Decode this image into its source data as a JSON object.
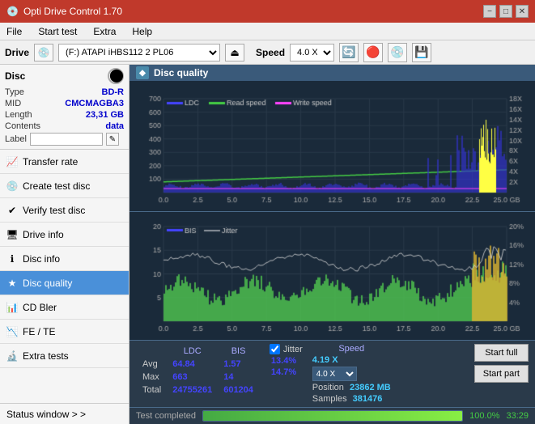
{
  "titlebar": {
    "title": "Opti Drive Control 1.70",
    "icon": "💿",
    "minimize": "−",
    "maximize": "□",
    "close": "✕"
  },
  "menu": {
    "items": [
      "File",
      "Start test",
      "Extra",
      "Help"
    ]
  },
  "drivebar": {
    "drive_label": "Drive",
    "drive_value": "(F:) ATAPI iHBS112  2 PL06",
    "speed_label": "Speed",
    "speed_value": "4.0 X"
  },
  "sidebar": {
    "disc_section": "Disc",
    "disc_type_key": "Type",
    "disc_type_val": "BD-R",
    "disc_mid_key": "MID",
    "disc_mid_val": "CMCMAGBA3",
    "disc_length_key": "Length",
    "disc_length_val": "23,31 GB",
    "disc_contents_key": "Contents",
    "disc_contents_val": "data",
    "disc_label_key": "Label",
    "disc_label_val": "",
    "nav_items": [
      {
        "id": "transfer-rate",
        "label": "Transfer rate",
        "icon": "📈",
        "active": false
      },
      {
        "id": "create-test-disc",
        "label": "Create test disc",
        "icon": "💿",
        "active": false
      },
      {
        "id": "verify-test-disc",
        "label": "Verify test disc",
        "icon": "✔",
        "active": false
      },
      {
        "id": "drive-info",
        "label": "Drive info",
        "icon": "🖥",
        "active": false
      },
      {
        "id": "disc-info",
        "label": "Disc info",
        "icon": "ℹ",
        "active": false
      },
      {
        "id": "disc-quality",
        "label": "Disc quality",
        "icon": "★",
        "active": true
      },
      {
        "id": "cd-bler",
        "label": "CD Bler",
        "icon": "📊",
        "active": false
      },
      {
        "id": "fe-te",
        "label": "FE / TE",
        "icon": "📉",
        "active": false
      },
      {
        "id": "extra-tests",
        "label": "Extra tests",
        "icon": "🔬",
        "active": false
      }
    ],
    "status_window": "Status window > >"
  },
  "dq_header": {
    "title": "Disc quality",
    "icon": "◆"
  },
  "chart_top": {
    "legend": [
      {
        "label": "LDC",
        "color": "#4444ff"
      },
      {
        "label": "Read speed",
        "color": "#44cc44"
      },
      {
        "label": "Write speed",
        "color": "#ff44ff"
      }
    ],
    "y_max": 700,
    "y_labels": [
      "700",
      "600",
      "500",
      "400",
      "300",
      "200",
      "100"
    ],
    "y_right_labels": [
      "18X",
      "16X",
      "14X",
      "12X",
      "10X",
      "8X",
      "6X",
      "4X",
      "2X"
    ],
    "x_labels": [
      "0.0",
      "2.5",
      "5.0",
      "7.5",
      "10.0",
      "12.5",
      "15.0",
      "17.5",
      "20.0",
      "22.5",
      "25.0 GB"
    ]
  },
  "chart_bottom": {
    "legend": [
      {
        "label": "BIS",
        "color": "#4444ff"
      },
      {
        "label": "Jitter",
        "color": "#ffffff"
      }
    ],
    "y_max": 20,
    "y_labels": [
      "20",
      "15",
      "10",
      "5"
    ],
    "y_right_labels": [
      "20%",
      "16%",
      "12%",
      "8%",
      "4%"
    ],
    "x_labels": [
      "0.0",
      "2.5",
      "5.0",
      "7.5",
      "10.0",
      "12.5",
      "15.0",
      "17.5",
      "20.0",
      "22.5",
      "25.0 GB"
    ]
  },
  "stats": {
    "col_headers": [
      "LDC",
      "BIS",
      "",
      "Jitter",
      "Speed"
    ],
    "avg_label": "Avg",
    "avg_ldc": "64.84",
    "avg_bis": "1.57",
    "avg_jitter": "13.4%",
    "avg_speed": "4.19 X",
    "max_label": "Max",
    "max_ldc": "663",
    "max_bis": "14",
    "max_jitter": "14.7%",
    "total_label": "Total",
    "total_ldc": "24755261",
    "total_bis": "601204",
    "speed_label": "Speed",
    "speed_val": "4.0 X",
    "position_label": "Position",
    "position_val": "23862 MB",
    "samples_label": "Samples",
    "samples_val": "381476",
    "jitter_checked": true,
    "jitter_label": "Jitter",
    "start_full_label": "Start full",
    "start_part_label": "Start part"
  },
  "progressbar": {
    "percent": 100,
    "percent_text": "100.0%",
    "time_text": "33:29",
    "status_text": "Test completed"
  }
}
